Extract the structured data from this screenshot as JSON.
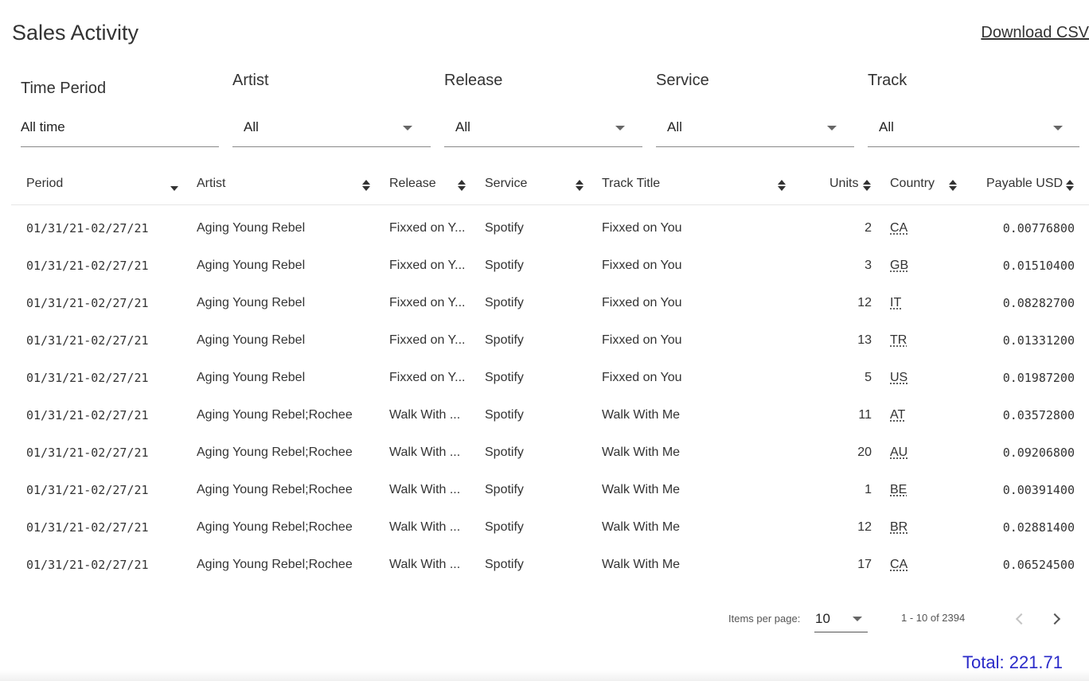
{
  "header": {
    "title": "Sales Activity",
    "download_label": "Download CSV"
  },
  "filters": {
    "time_period": {
      "label": "Time Period",
      "value": "All time"
    },
    "artist": {
      "label": "Artist",
      "value": "All"
    },
    "release": {
      "label": "Release",
      "value": "All"
    },
    "service": {
      "label": "Service",
      "value": "All"
    },
    "track": {
      "label": "Track",
      "value": "All"
    }
  },
  "table": {
    "columns": {
      "period": "Period",
      "artist": "Artist",
      "release": "Release",
      "service": "Service",
      "track_title": "Track Title",
      "units": "Units",
      "country": "Country",
      "payable": "Payable USD"
    },
    "rows": [
      {
        "period": "01/31/21-02/27/21",
        "artist": "Aging Young Rebel",
        "release": "Fixxed on Y...",
        "service": "Spotify",
        "track": "Fixxed on You",
        "units": "2",
        "country": "CA",
        "payable": "0.00776800"
      },
      {
        "period": "01/31/21-02/27/21",
        "artist": "Aging Young Rebel",
        "release": "Fixxed on Y...",
        "service": "Spotify",
        "track": "Fixxed on You",
        "units": "3",
        "country": "GB",
        "payable": "0.01510400"
      },
      {
        "period": "01/31/21-02/27/21",
        "artist": "Aging Young Rebel",
        "release": "Fixxed on Y...",
        "service": "Spotify",
        "track": "Fixxed on You",
        "units": "12",
        "country": "IT",
        "payable": "0.08282700"
      },
      {
        "period": "01/31/21-02/27/21",
        "artist": "Aging Young Rebel",
        "release": "Fixxed on Y...",
        "service": "Spotify",
        "track": "Fixxed on You",
        "units": "13",
        "country": "TR",
        "payable": "0.01331200"
      },
      {
        "period": "01/31/21-02/27/21",
        "artist": "Aging Young Rebel",
        "release": "Fixxed on Y...",
        "service": "Spotify",
        "track": "Fixxed on You",
        "units": "5",
        "country": "US",
        "payable": "0.01987200"
      },
      {
        "period": "01/31/21-02/27/21",
        "artist": "Aging Young Rebel;Rochee",
        "release": "Walk With ...",
        "service": "Spotify",
        "track": "Walk With Me",
        "units": "11",
        "country": "AT",
        "payable": "0.03572800"
      },
      {
        "period": "01/31/21-02/27/21",
        "artist": "Aging Young Rebel;Rochee",
        "release": "Walk With ...",
        "service": "Spotify",
        "track": "Walk With Me",
        "units": "20",
        "country": "AU",
        "payable": "0.09206800"
      },
      {
        "period": "01/31/21-02/27/21",
        "artist": "Aging Young Rebel;Rochee",
        "release": "Walk With ...",
        "service": "Spotify",
        "track": "Walk With Me",
        "units": "1",
        "country": "BE",
        "payable": "0.00391400"
      },
      {
        "period": "01/31/21-02/27/21",
        "artist": "Aging Young Rebel;Rochee",
        "release": "Walk With ...",
        "service": "Spotify",
        "track": "Walk With Me",
        "units": "12",
        "country": "BR",
        "payable": "0.02881400"
      },
      {
        "period": "01/31/21-02/27/21",
        "artist": "Aging Young Rebel;Rochee",
        "release": "Walk With ...",
        "service": "Spotify",
        "track": "Walk With Me",
        "units": "17",
        "country": "CA",
        "payable": "0.06524500"
      }
    ]
  },
  "paginator": {
    "items_per_page_label": "Items per page:",
    "items_per_page_value": "10",
    "range_label": "1 - 10 of 2394"
  },
  "summary": {
    "total": "Total: 221.71"
  },
  "colors": {
    "total_text": "#2a2ac9"
  }
}
